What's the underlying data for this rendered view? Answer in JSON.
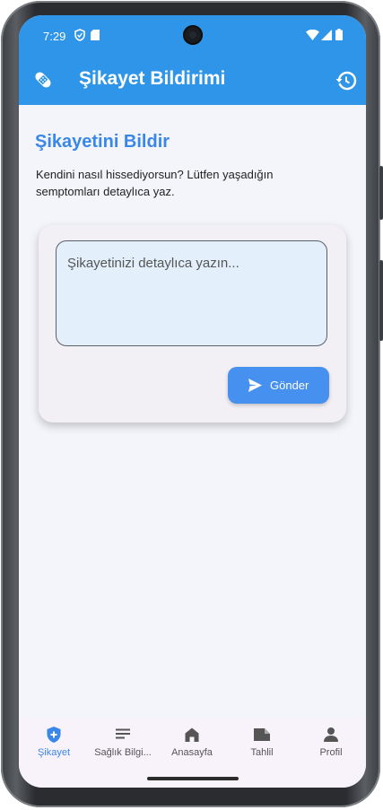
{
  "status_bar": {
    "time": "7:29"
  },
  "app_bar": {
    "title": "Şikayet Bildirimi"
  },
  "main": {
    "heading": "Şikayetini Bildir",
    "description": "Kendini nasıl hissediyorsun? Lütfen yaşadığın semptomları detaylıca yaz.",
    "complaint_placeholder": "Şikayetinizi detaylıca yazın...",
    "send_label": "Gönder"
  },
  "bottom_nav": {
    "items": [
      {
        "label": "Şikayet",
        "icon": "shield-plus-icon",
        "active": true
      },
      {
        "label": "Sağlık Bilgi...",
        "icon": "notes-icon",
        "active": false
      },
      {
        "label": "Anasayfa",
        "icon": "home-icon",
        "active": false
      },
      {
        "label": "Tahlil",
        "icon": "label-icon",
        "active": false
      },
      {
        "label": "Profil",
        "icon": "person-icon",
        "active": false
      }
    ]
  },
  "colors": {
    "primary": "#2f95e8",
    "accent": "#3a87ea",
    "button": "#4690ef",
    "textarea_bg": "#e3f0fc",
    "card_bg": "#f2eff5",
    "nav_bg": "#f8f2fb"
  }
}
